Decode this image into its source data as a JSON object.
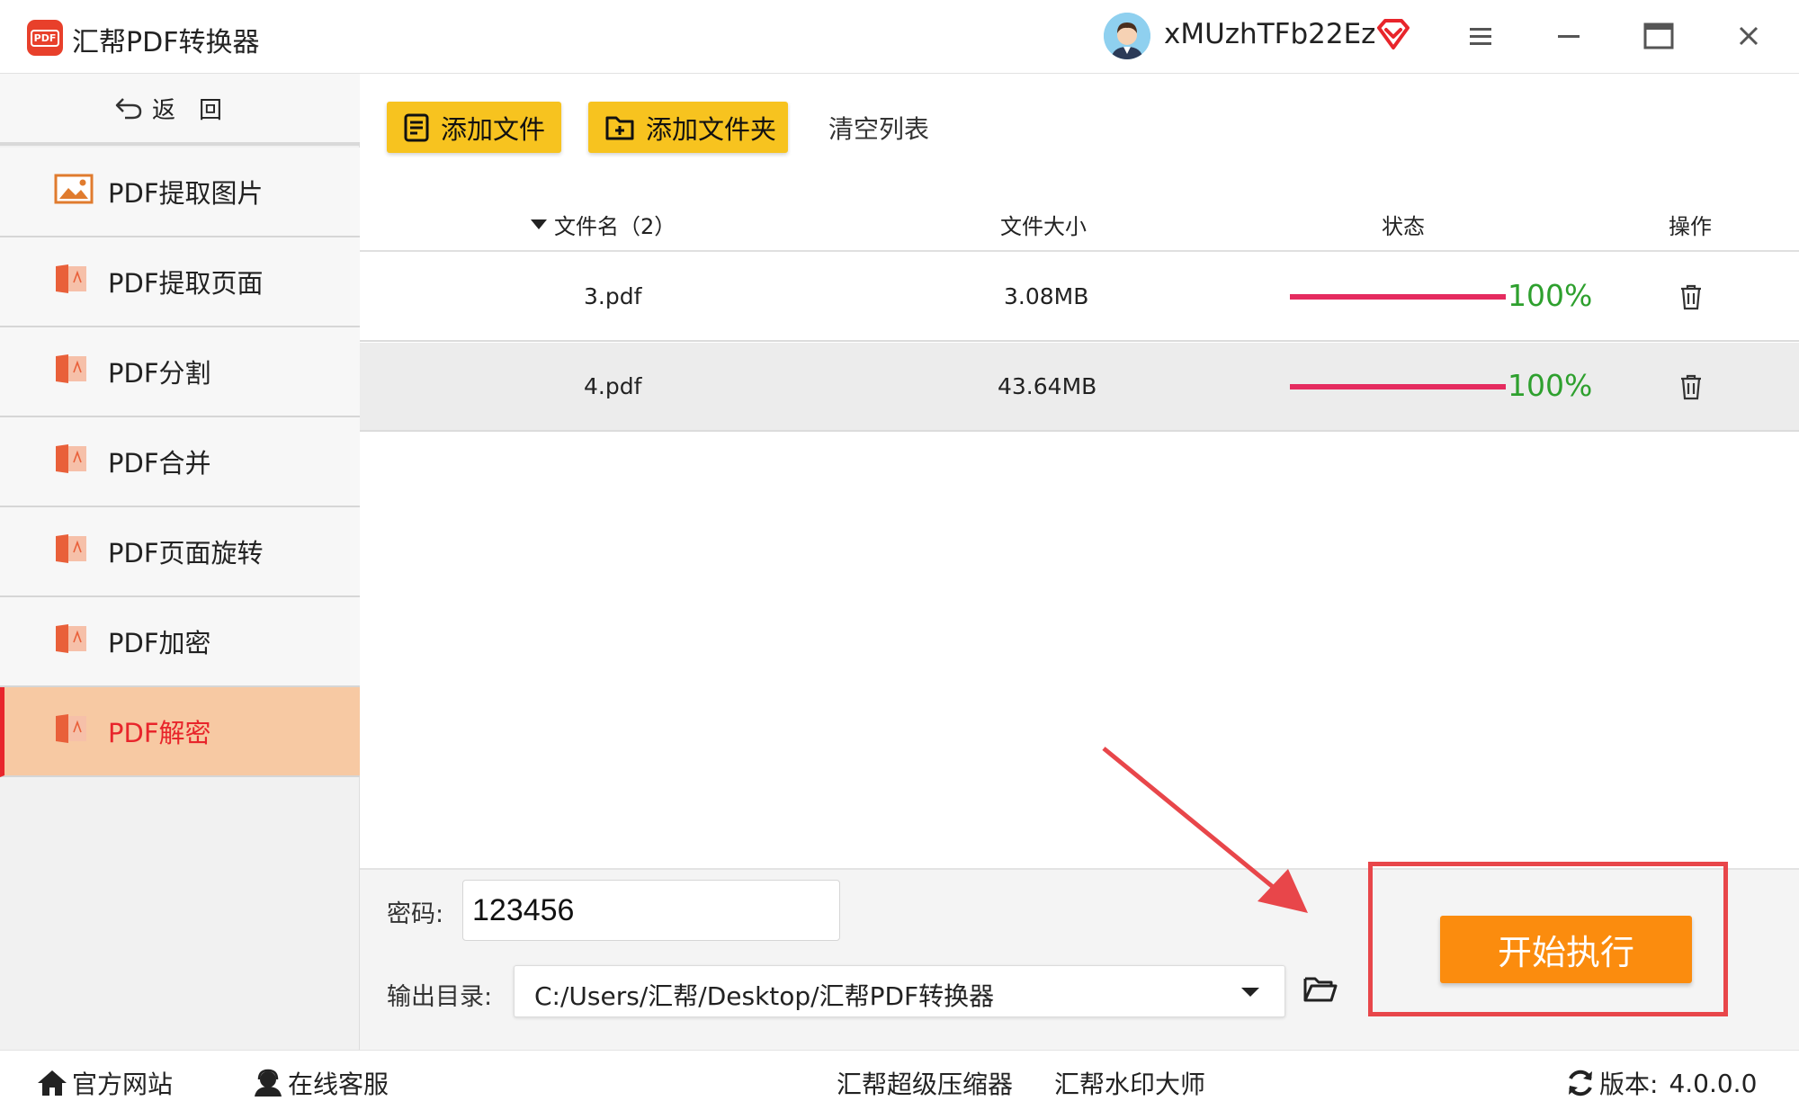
{
  "app": {
    "title": "汇帮PDF转换器",
    "logo_text": "PDF",
    "username": "xMUzhTFb22Ez"
  },
  "sidebar": {
    "back_label": "返回",
    "items": [
      {
        "label": "PDF提取图片",
        "icon": "image-icon"
      },
      {
        "label": "PDF提取页面",
        "icon": "pdf-file-icon"
      },
      {
        "label": "PDF分割",
        "icon": "pdf-file-icon"
      },
      {
        "label": "PDF合并",
        "icon": "pdf-file-icon"
      },
      {
        "label": "PDF页面旋转",
        "icon": "pdf-file-icon"
      },
      {
        "label": "PDF加密",
        "icon": "pdf-file-icon"
      },
      {
        "label": "PDF解密",
        "icon": "pdf-file-icon",
        "active": true
      }
    ]
  },
  "toolbar": {
    "add_file_label": "添加文件",
    "add_folder_label": "添加文件夹",
    "clear_list_label": "清空列表"
  },
  "table": {
    "headers": {
      "filename": "文件名（2）",
      "size": "文件大小",
      "status": "状态",
      "actions": "操作"
    },
    "rows": [
      {
        "name": "3.pdf",
        "size": "3.08MB",
        "progress": 1.0,
        "progress_text": "100%"
      },
      {
        "name": "4.pdf",
        "size": "43.64MB",
        "progress": 1.0,
        "progress_text": "100%"
      }
    ]
  },
  "settings": {
    "password_label": "密码:",
    "password_value": "123456",
    "output_label": "输出目录:",
    "output_path": "C:/Users/汇帮/Desktop/汇帮PDF转换器",
    "start_label": "开始执行"
  },
  "footer": {
    "website_label": "官方网站",
    "support_label": "在线客服",
    "compressor_label": "汇帮超级压缩器",
    "watermark_label": "汇帮水印大师",
    "version_label": "版本:",
    "version_value": "4.0.0.0"
  },
  "colors": {
    "accent_yellow": "#f7c31f",
    "start_orange": "#fb8c0e",
    "active_bg": "#f7c9a3",
    "active_text": "#e8252b",
    "progress_fill": "#e52b5f",
    "percent_green": "#2ea02e",
    "highlight_red": "#e8464a"
  }
}
